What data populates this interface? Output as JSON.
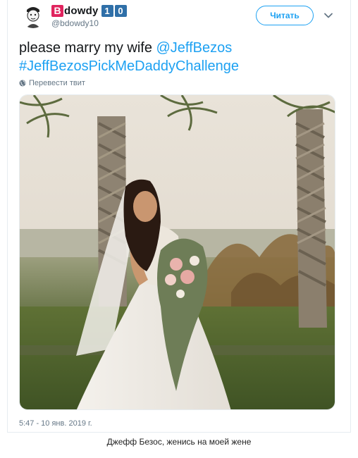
{
  "user": {
    "name_initial": "B",
    "name_rest": "dowdy",
    "name_badges": [
      "1",
      "0"
    ],
    "handle": "@bdowdy10"
  },
  "header": {
    "follow_label": "Читать",
    "menu_icon": "chevron-down-icon"
  },
  "tweet": {
    "text_plain": "please marry my wife ",
    "mention": "@JeffBezos",
    "hashtag": "#JeffBezosPickMeDaddyChallenge",
    "translate_label": "Перевести твит",
    "timestamp": "5:47 - 10 янв. 2019 г."
  },
  "caption": "Джефф Безос, женись на моей жене",
  "colors": {
    "accent": "#1da1f2",
    "name_badge_red": "#e0245e",
    "name_badge_blue": "#2f6fa8",
    "secondary_text": "#657786"
  }
}
